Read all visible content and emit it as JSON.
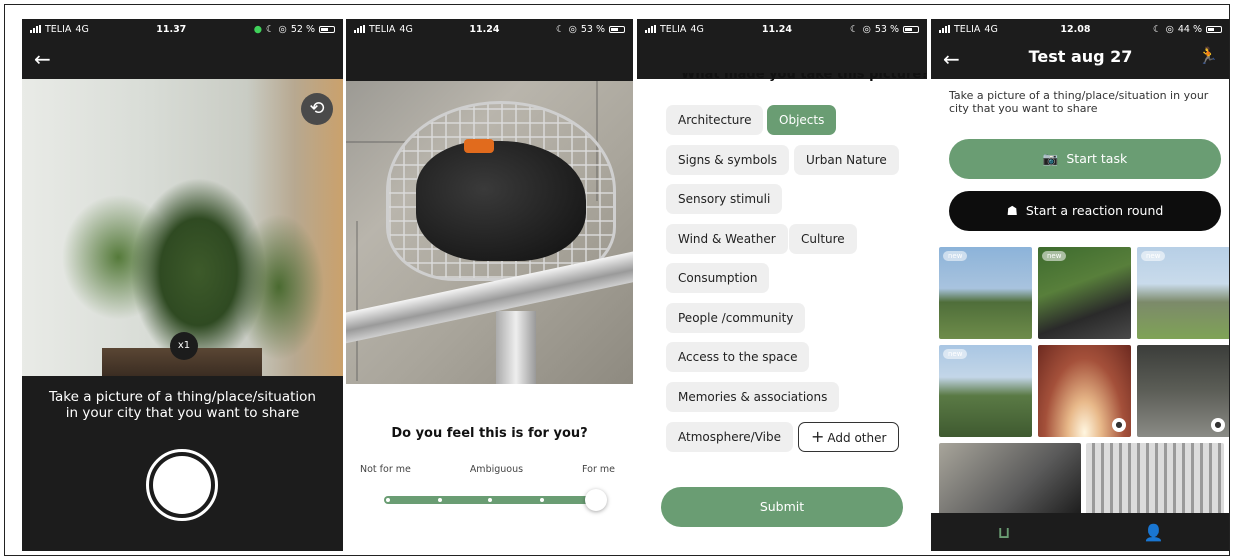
{
  "screen1": {
    "status": {
      "carrier": "TELIA",
      "network": "4G",
      "time": "11.37",
      "battery": "52 %"
    },
    "zoom_label": "x1",
    "instruction": "Take a picture of a thing/place/situation in your city that you want to share"
  },
  "screen2": {
    "status": {
      "carrier": "TELIA",
      "network": "4G",
      "time": "11.24",
      "battery": "53 %"
    },
    "question": "Do you feel this is for you?",
    "scale": {
      "left": "Not for me",
      "middle": "Ambiguous",
      "right": "For me",
      "value": 1.0
    }
  },
  "screen3": {
    "status": {
      "carrier": "TELIA",
      "network": "4G",
      "time": "11.24",
      "battery": "53 %"
    },
    "question": "What made you take this picture?",
    "chips": [
      {
        "label": "Architecture",
        "selected": false
      },
      {
        "label": "Objects",
        "selected": true
      },
      {
        "label": "Signs & symbols",
        "selected": false
      },
      {
        "label": "Urban Nature",
        "selected": false
      },
      {
        "label": "Sensory stimuli",
        "selected": false
      },
      {
        "label": "Wind & Weather",
        "selected": false
      },
      {
        "label": "Culture",
        "selected": false
      },
      {
        "label": "Consumption",
        "selected": false
      },
      {
        "label": "People /community",
        "selected": false
      },
      {
        "label": "Access to the space",
        "selected": false
      },
      {
        "label": "Memories & associations",
        "selected": false
      },
      {
        "label": "Atmosphere/Vibe",
        "selected": false
      }
    ],
    "add_other": "Add other",
    "submit": "Submit"
  },
  "screen4": {
    "status": {
      "carrier": "TELIA",
      "network": "4G",
      "time": "12.08",
      "battery": "44 %"
    },
    "title": "Test aug 27",
    "description": "Take a picture of a thing/place/situation in your city that you want to share",
    "start_task": "Start task",
    "reaction_round": "Start a reaction round",
    "badge_new": "new"
  },
  "colors": {
    "accent": "#6a9d73",
    "dark": "#1c1c1c"
  }
}
